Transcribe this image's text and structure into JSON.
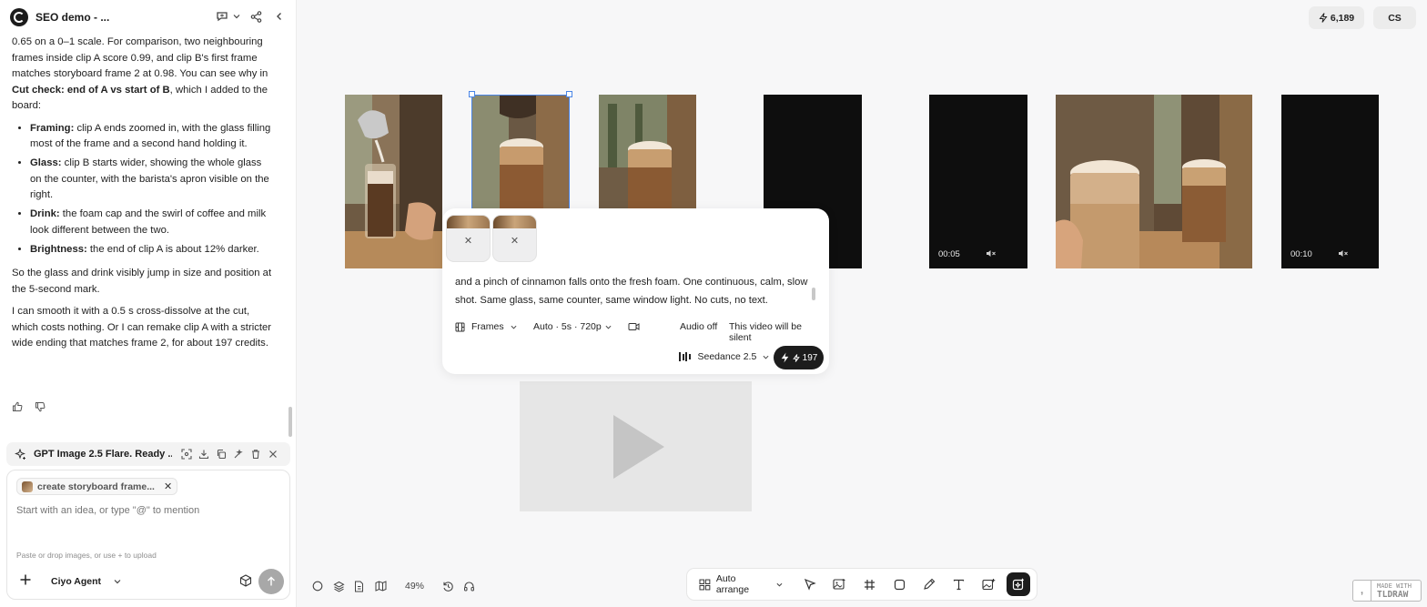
{
  "app": {
    "project_title": "SEO demo - ...",
    "credits": "6,189",
    "user_initials": "CS"
  },
  "chat": {
    "p1_pre": "0.65 on a 0–1 scale. For comparison, two neighbouring frames inside clip A score 0.99, and clip B's first frame matches storyboard frame 2 at 0.98. You can see why in ",
    "p1_bold": "Cut check: end of A vs start of B",
    "p1_post": ", which I added to the board:",
    "bullets": [
      {
        "label": "Framing:",
        "text": " clip A ends zoomed in, with the glass filling most of the frame and a second hand holding it."
      },
      {
        "label": "Glass:",
        "text": " clip B starts wider, showing the whole glass on the counter, with the barista's apron visible on the right."
      },
      {
        "label": "Drink:",
        "text": " the foam cap and the swirl of coffee and milk look different between the two."
      },
      {
        "label": "Brightness:",
        "text": " the end of clip A is about 12% darker."
      }
    ],
    "p2": "So the glass and drink visibly jump in size and position at the 5-second mark.",
    "p3": "I can smooth it with a 0.5 s cross-dissolve at the cut, which costs nothing. Or I can remake clip A with a stricter wide ending that matches frame 2, for about 197 credits."
  },
  "generation_bar": {
    "text": "GPT Image 2.5 Flare. Ready ..."
  },
  "composer": {
    "chip_label": "create storyboard frame...",
    "placeholder": "Start with an idea, or type \"@\" to mention",
    "upload_hint": "Paste or drop images, or use + to upload",
    "agent": "Ciyo Agent"
  },
  "canvas": {
    "clip1_time": "00:05",
    "clip2_time": "00:10",
    "zoom": "49%"
  },
  "prompt_card": {
    "text": "and a pinch of cinnamon falls onto the fresh foam. One continuous, calm, slow shot. Same glass, same counter, same window light. No cuts, no text.",
    "frames_label": "Frames",
    "settings_label": "Auto · 5s · 720p",
    "audio_label": "Audio off",
    "silent_note": "This video will be silent",
    "model": "Seedance 2.5",
    "cost": "197"
  },
  "toolbar": {
    "arrange_label": "Auto arrange"
  },
  "badge": {
    "line1": "MADE WITH",
    "line2": "TLDRAW",
    "mark": ","
  },
  "colors": {
    "selection": "#4a85e6",
    "primary_button": "#1c1c1c"
  }
}
